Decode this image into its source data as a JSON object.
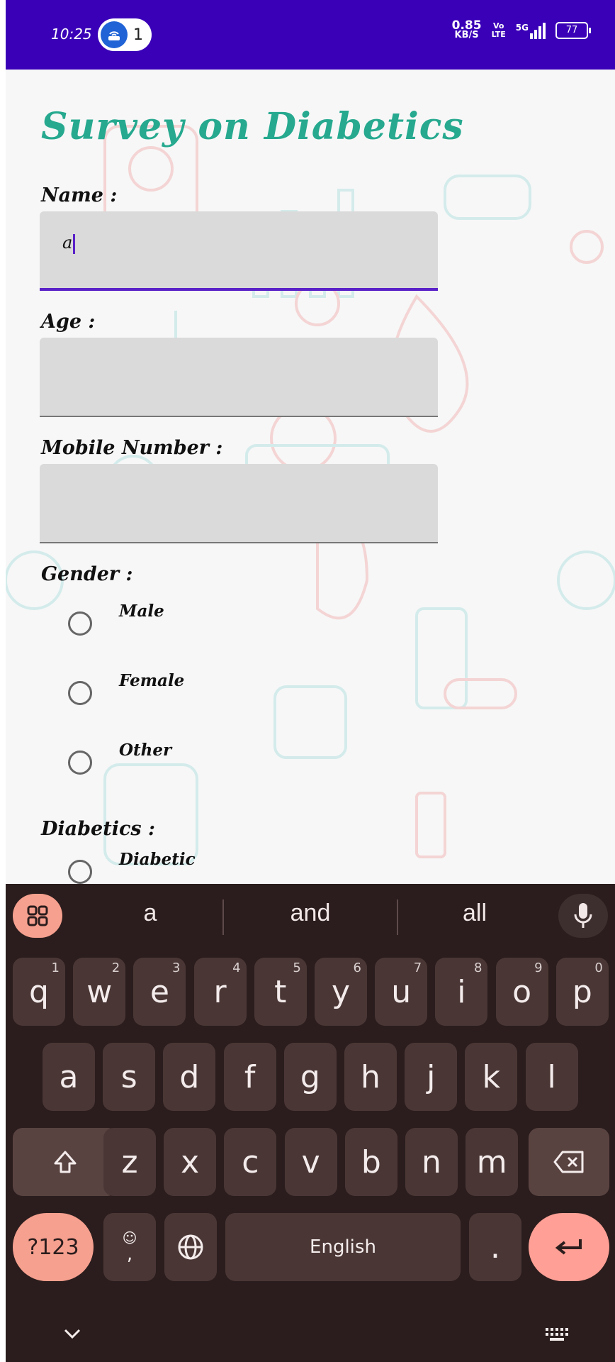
{
  "status_bar": {
    "time": "10:25",
    "hotspot_count": "1",
    "net_speed_value": "0.85",
    "net_speed_unit": "KB/S",
    "volte_top": "Vo",
    "volte_bottom": "LTE",
    "signal": "5G",
    "battery": "77"
  },
  "form": {
    "title": "Survey on Diabetics",
    "name_label": "Name :",
    "name_value": "a",
    "age_label": "Age :",
    "mobile_label": "Mobile Number :",
    "gender_label": "Gender :",
    "gender_options": [
      "Male",
      "Female",
      "Other"
    ],
    "diabetics_label": "Diabetics :",
    "diabetics_options": [
      "Diabetic"
    ]
  },
  "keyboard": {
    "suggestions": [
      "a",
      "and",
      "all"
    ],
    "row1": [
      {
        "key": "q",
        "hint": "1"
      },
      {
        "key": "w",
        "hint": "2"
      },
      {
        "key": "e",
        "hint": "3"
      },
      {
        "key": "r",
        "hint": "4"
      },
      {
        "key": "t",
        "hint": "5"
      },
      {
        "key": "y",
        "hint": "6"
      },
      {
        "key": "u",
        "hint": "7"
      },
      {
        "key": "i",
        "hint": "8"
      },
      {
        "key": "o",
        "hint": "9"
      },
      {
        "key": "p",
        "hint": "0"
      }
    ],
    "row2": [
      "a",
      "s",
      "d",
      "f",
      "g",
      "h",
      "j",
      "k",
      "l"
    ],
    "row3": [
      "z",
      "x",
      "c",
      "v",
      "b",
      "n",
      "m"
    ],
    "symbols_label": "?123",
    "comma_label": ",",
    "space_label": "English",
    "period_label": "."
  },
  "colors": {
    "status_bar": "#3a00b8",
    "title": "#26a98f",
    "active_underline": "#5a22c8",
    "keyboard_bg": "#2b1d1d",
    "key_bg": "#4a3735",
    "accent_key": "#f6a08f"
  }
}
